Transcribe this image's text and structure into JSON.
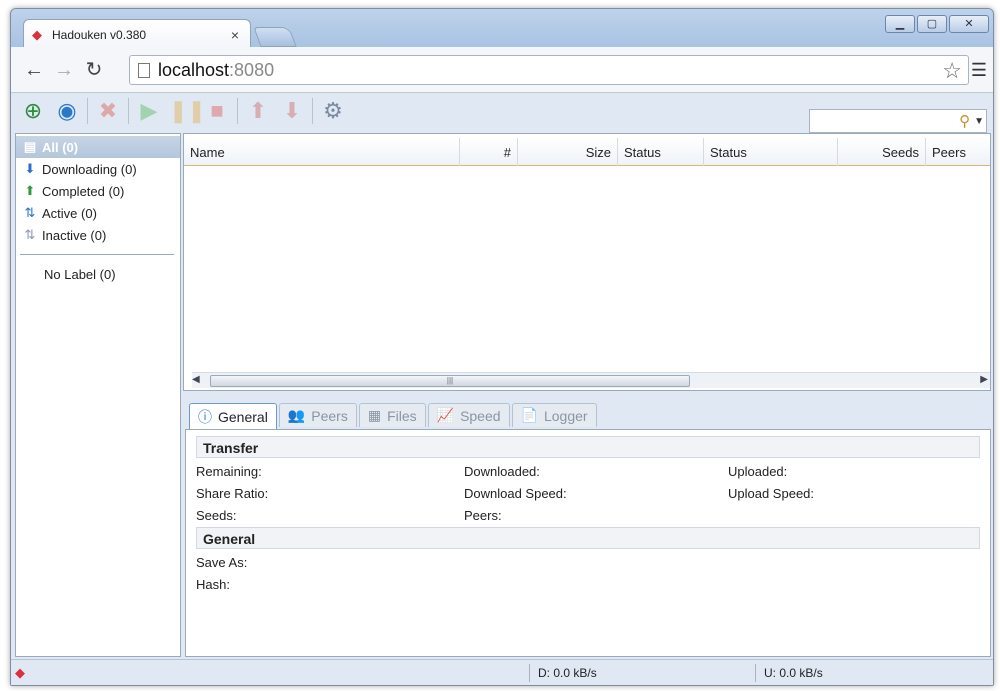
{
  "browser": {
    "tab_title": "Hadouken v0.380",
    "tab_close": "×",
    "window_controls": {
      "minimize": "▁",
      "maximize": "▢",
      "close": "✕"
    },
    "url_host": "localhost",
    "url_port": ":8080"
  },
  "toolbar": {
    "icons": [
      "add-torrent-icon",
      "add-url-icon",
      "remove-icon",
      "start-icon",
      "pause-icon",
      "stop-icon",
      "move-up-icon",
      "move-down-icon",
      "settings-icon"
    ]
  },
  "sidebar": {
    "items": [
      {
        "label": "All (0)",
        "icon": "all-icon"
      },
      {
        "label": "Downloading (0)",
        "icon": "download-arrow-icon"
      },
      {
        "label": "Completed (0)",
        "icon": "upload-arrow-icon"
      },
      {
        "label": "Active (0)",
        "icon": "active-arrows-icon"
      },
      {
        "label": "Inactive (0)",
        "icon": "inactive-arrows-icon"
      }
    ],
    "labels": [
      {
        "label": "No Label (0)"
      }
    ]
  },
  "grid": {
    "columns": [
      "Name",
      "#",
      "Size",
      "Status",
      "Status",
      "Seeds",
      "Peers"
    ]
  },
  "details": {
    "tabs": [
      {
        "label": "General",
        "icon": "info-icon",
        "active": true
      },
      {
        "label": "Peers",
        "icon": "peers-icon",
        "active": false
      },
      {
        "label": "Files",
        "icon": "files-icon",
        "active": false
      },
      {
        "label": "Speed",
        "icon": "speed-chart-icon",
        "active": false
      },
      {
        "label": "Logger",
        "icon": "logger-icon",
        "active": false
      }
    ],
    "transfer_title": "Transfer",
    "remaining": "Remaining:",
    "downloaded": "Downloaded:",
    "uploaded": "Uploaded:",
    "share_ratio": "Share Ratio:",
    "download_speed": "Download Speed:",
    "upload_speed": "Upload Speed:",
    "seeds": "Seeds:",
    "peers": "Peers:",
    "general_title": "General",
    "save_as": "Save As:",
    "hash": "Hash:"
  },
  "status": {
    "download": "D: 0.0 kB/s",
    "upload": "U: 0.0 kB/s"
  },
  "colors": {
    "brand": "#d8333a",
    "selection": "#b4c6db",
    "frame": "#dfe8f3"
  }
}
